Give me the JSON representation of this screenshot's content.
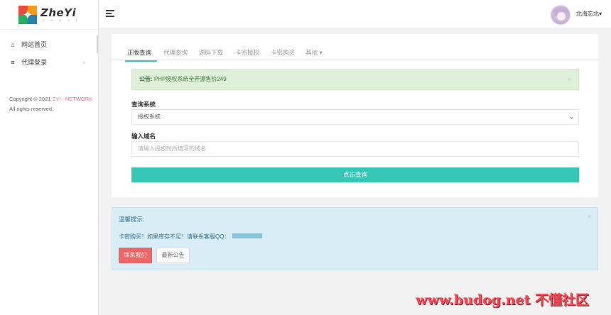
{
  "sidebar": {
    "brand": {
      "name": "ZheYi",
      "sub": "Z H E Y I"
    },
    "items": [
      {
        "label": "网站首页",
        "icon": "home-icon",
        "glyph": "⌂"
      },
      {
        "label": "代理登录",
        "icon": "list-icon",
        "glyph": "≡",
        "chevron": "›"
      }
    ],
    "copyright": {
      "prefix": "Copyright © 2021 ",
      "brand": "ZYI - NETWORK",
      "suffix": " All rights reserved."
    }
  },
  "topbar": {
    "username": "北海忘北▾"
  },
  "tabs": [
    {
      "label": "正版查询",
      "active": true
    },
    {
      "label": "代理查询"
    },
    {
      "label": "源码下载"
    },
    {
      "label": "卡密授权"
    },
    {
      "label": "卡密购买"
    },
    {
      "label": "其他 ▾"
    }
  ],
  "notice": {
    "prefix": "公告:",
    "text": " PHP授权系统全开源售价249",
    "close": "×"
  },
  "form": {
    "system_label": "查询系统",
    "system_value": "授权系统",
    "system_caret": "⌄",
    "domain_label": "输入域名",
    "domain_placeholder": "请输入授权时所填写的域名",
    "submit_label": "点击查询"
  },
  "tips": {
    "title": "温馨提示:",
    "text": "卡密购买！如果库存不足！请联系客服QQ：",
    "close": "×",
    "contact_label": "联系我们",
    "news_label": "最新公告"
  },
  "watermark": "www.budog.net 不懂社区",
  "colors": {
    "accent": "#36c6b7",
    "notice_bg": "#dff0d8",
    "tips_bg": "#d9edf7",
    "danger": "#ee6666"
  }
}
